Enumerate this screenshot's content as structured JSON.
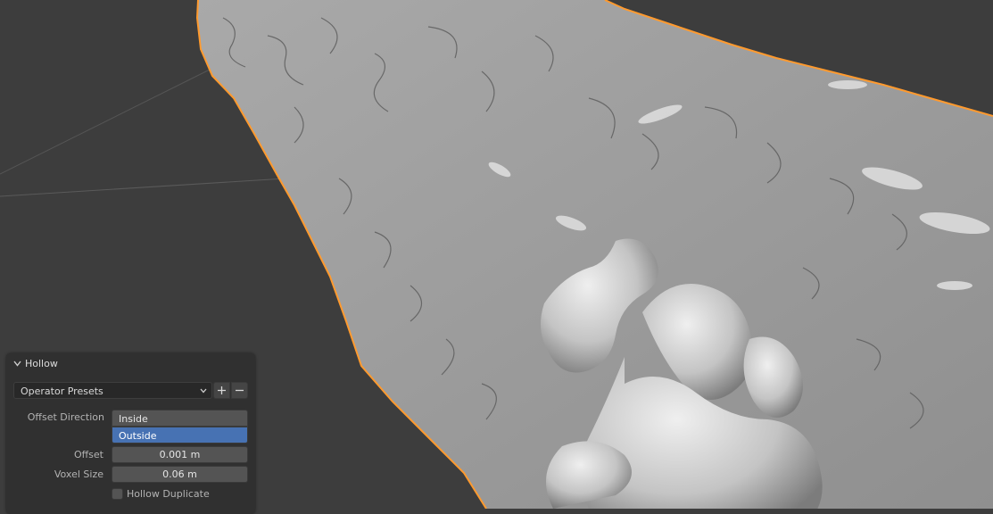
{
  "viewport": {
    "background_color": "#3d3d3d",
    "mesh_color": "#9e9e9e",
    "outline_color": "#ff9a2e"
  },
  "panel": {
    "title": "Hollow",
    "presets": {
      "label": "Operator Presets",
      "add_icon": "plus-icon",
      "remove_icon": "minus-icon"
    },
    "offset_direction": {
      "label": "Offset Direction",
      "options": [
        "Inside",
        "Outside"
      ],
      "selected": "Outside"
    },
    "offset": {
      "label": "Offset",
      "value": "0.001 m"
    },
    "voxel_size": {
      "label": "Voxel Size",
      "value": "0.06 m"
    },
    "hollow_duplicate": {
      "label": "Hollow Duplicate",
      "checked": false
    }
  },
  "colors": {
    "panel_bg": "#303030",
    "field_bg": "#545454",
    "selected_accent": "#4772b3"
  }
}
